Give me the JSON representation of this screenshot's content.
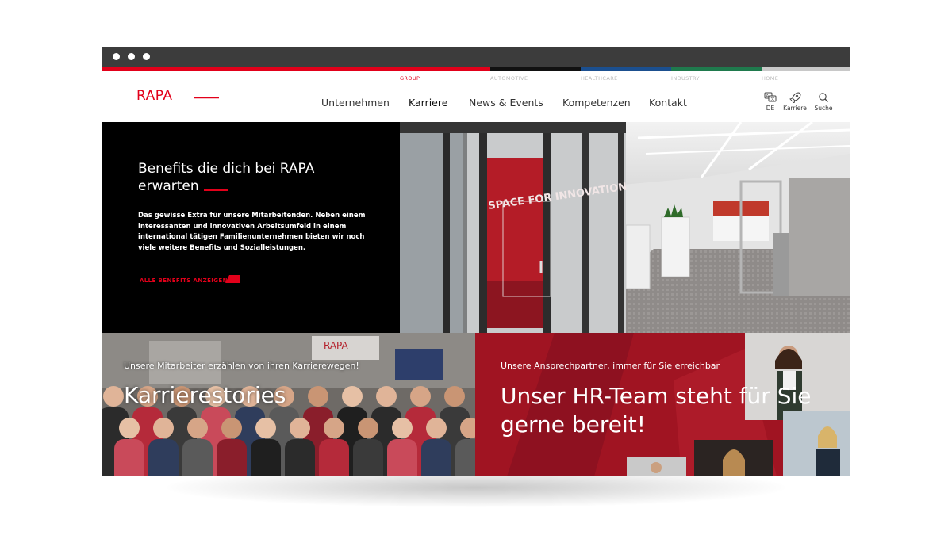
{
  "segments": [
    {
      "label": "GROUP",
      "color": "#e2001a",
      "label_color": "#e2001a"
    },
    {
      "label": "AUTOMOTIVE",
      "color": "#111111",
      "label_color": "#bbbbbb"
    },
    {
      "label": "HEALTHCARE",
      "color": "#1b4f8f",
      "label_color": "#bbbbbb"
    },
    {
      "label": "INDUSTRY",
      "color": "#1f7a4d",
      "label_color": "#bbbbbb"
    },
    {
      "label": "HOME",
      "color": "#c8c8c8",
      "label_color": "#bbbbbb"
    }
  ],
  "logo": {
    "text": "RAPA",
    "color": "#e2001a"
  },
  "nav": [
    "Unternehmen",
    "Karriere",
    "News & Events",
    "Kompetenzen",
    "Kontakt"
  ],
  "nav_active": "Karriere",
  "utilities": [
    {
      "label": "DE",
      "icon": "language-icon"
    },
    {
      "label": "Karriere",
      "icon": "rocket-icon"
    },
    {
      "label": "Suche",
      "icon": "search-icon"
    }
  ],
  "hero": {
    "title": "Benefits die dich bei RAPA erwarten",
    "text": "Das gewisse Extra für unsere Mitarbeitenden. Neben einem interessanten und innovativen Arbeitsumfeld in einem international tätigen Familienunternehmen bieten wir noch viele weitere Benefits und Sozialleistungen.",
    "cta": "ALLE BENEFITS ANZEIGEN",
    "glass_text": "SPACE FOR INNOVATION"
  },
  "stories": {
    "subtitle": "Unsere Mitarbeiter erzählen von ihren Karrierewegen!",
    "title": "Karrierestories",
    "sign_text": "RAPA"
  },
  "hr": {
    "subtitle": "Unsere Ansprechpartner, immer für Sie erreichbar",
    "title": "Unser HR-Team steht für Sie gerne bereit!"
  },
  "colors": {
    "accent": "#e2001a",
    "chrome": "#3c3c3c",
    "hr_bg": "#a01422"
  }
}
